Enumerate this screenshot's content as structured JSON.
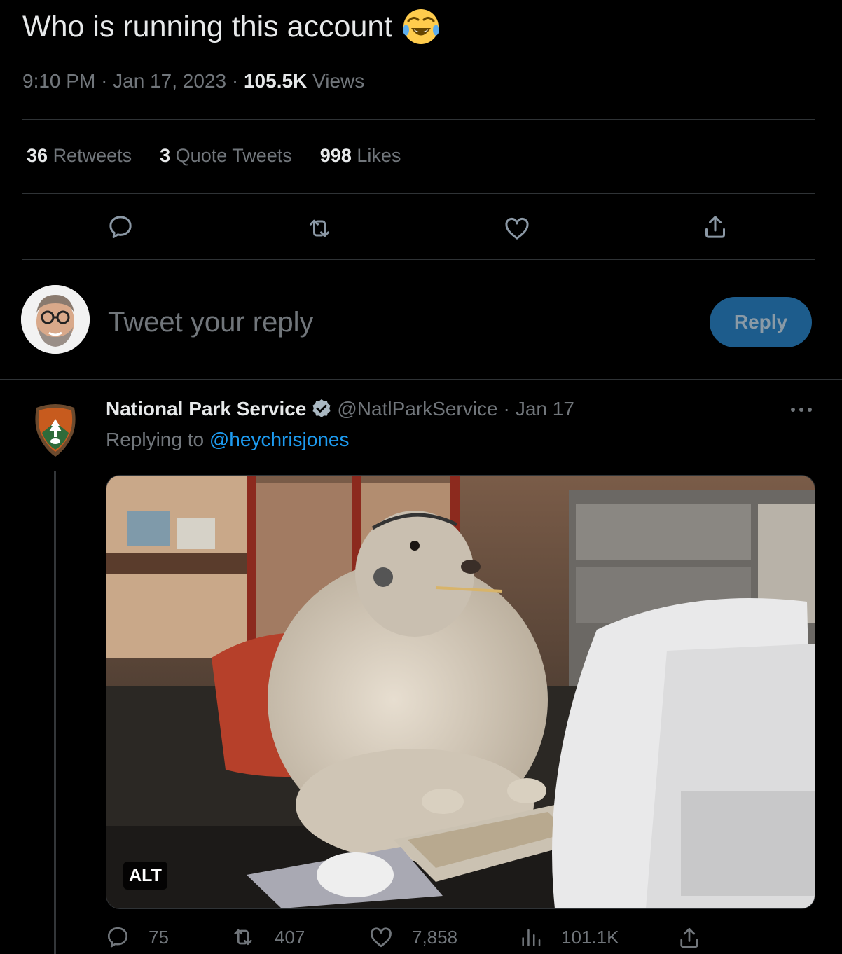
{
  "tweet": {
    "text": "Who is running this account",
    "emoji_icon": "tears-of-joy-emoji",
    "time": "9:10 PM",
    "date": "Jan 17, 2023",
    "views_count": "105.5K",
    "views_label": "Views",
    "separator": "·"
  },
  "stats": {
    "retweets_count": "36",
    "retweets_label": "Retweets",
    "quotes_count": "3",
    "quotes_label": "Quote Tweets",
    "likes_count": "998",
    "likes_label": "Likes"
  },
  "actions": {
    "icons": [
      "reply-icon",
      "retweet-icon",
      "like-icon",
      "share-icon"
    ]
  },
  "composer": {
    "placeholder": "Tweet your reply",
    "button_label": "Reply"
  },
  "reply": {
    "author_name": "National Park Service",
    "handle": "@NatlParkService",
    "separator": "·",
    "date": "Jan 17",
    "replying_prefix": "Replying to",
    "replying_to": "@heychrisjones",
    "alt_label": "ALT",
    "counts": {
      "replies": "75",
      "retweets": "407",
      "likes": "7,858",
      "views": "101.1K"
    }
  },
  "colors": {
    "background": "#000000",
    "text": "#e7e9ea",
    "muted": "#71767b",
    "accent": "#1d9bf0",
    "reply_button": "#1d5c8c",
    "divider": "#2f3336"
  }
}
